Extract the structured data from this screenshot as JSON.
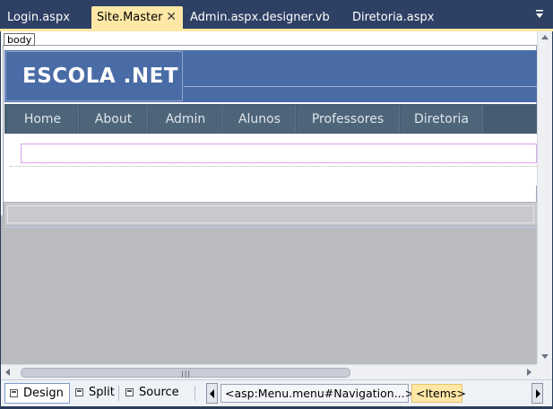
{
  "tabs": [
    {
      "label": "Login.aspx",
      "active": false
    },
    {
      "label": "Site.Master",
      "active": true,
      "close": "✕"
    },
    {
      "label": "Admin.aspx.designer.vb",
      "active": false
    },
    {
      "label": "Diretoria.aspx",
      "active": false
    }
  ],
  "designer": {
    "body_tag": "body",
    "site_title": "ESCOLA .NET",
    "menu_items": [
      "Home",
      "About",
      "Admin",
      "Alunos",
      "Professores",
      "Diretoria"
    ]
  },
  "bottombar": {
    "views": [
      "Design",
      "Split",
      "Source"
    ],
    "active_view": "Design",
    "breadcrumb_path": "<asp:Menu.menu#Navigation...>",
    "breadcrumb_current": "<Items>"
  },
  "colors": {
    "tabstrip_bg": "#2e4064",
    "active_tab": "#ffe8a6",
    "header_blue": "#4a6ca6",
    "menu_bar": "#465c71"
  },
  "icons": {
    "tab_menu": "dropdown-arrow-icon",
    "close": "close-icon",
    "view": "view-mode-icon"
  }
}
